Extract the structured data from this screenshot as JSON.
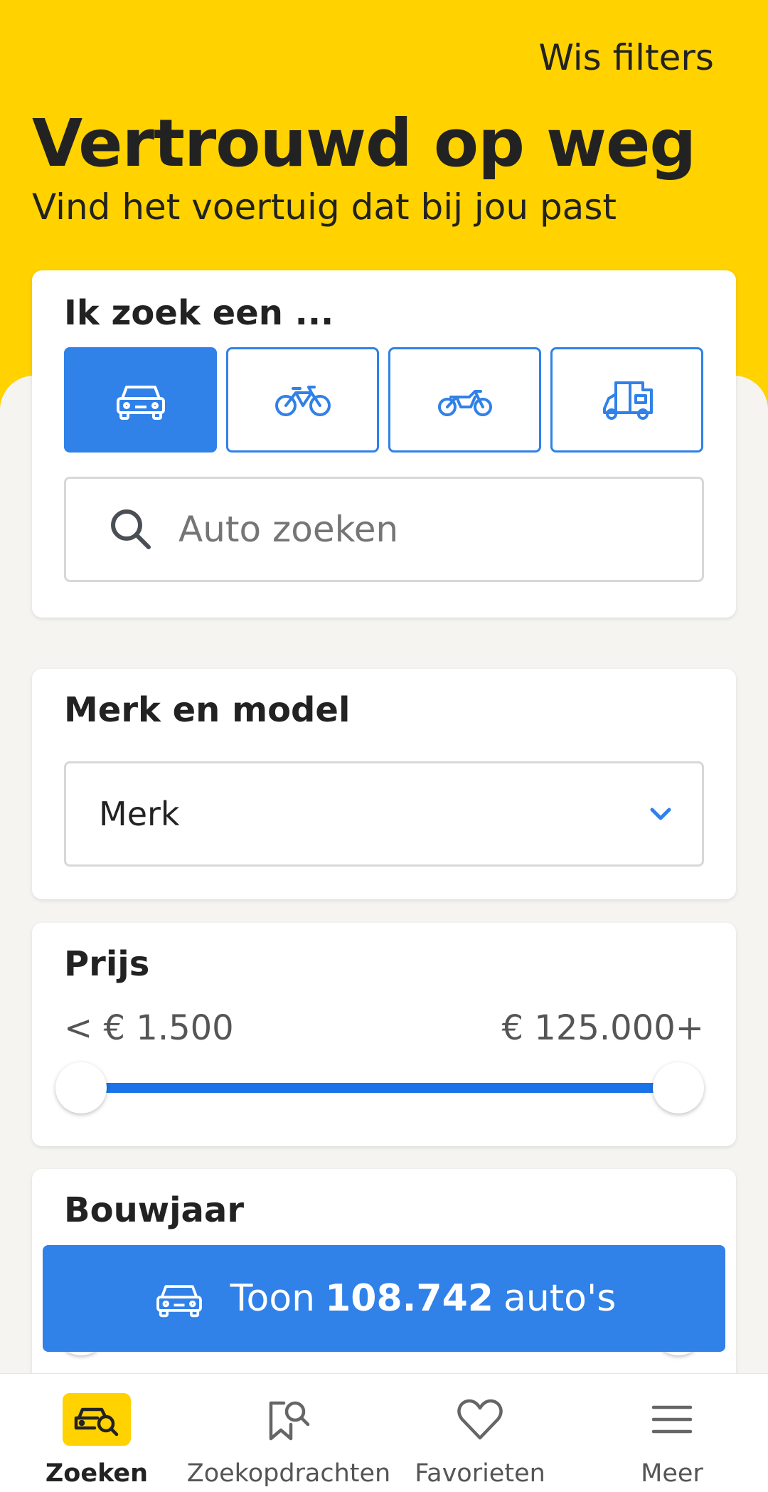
{
  "header": {
    "clear_filters": "Wis filters",
    "title": "Vertrouwd op weg",
    "subtitle": "Vind het voertuig dat bij jou past"
  },
  "search_card": {
    "heading": "Ik zoek een ...",
    "vehicle_types": [
      {
        "icon": "car-icon",
        "selected": true
      },
      {
        "icon": "bicycle-icon",
        "selected": false
      },
      {
        "icon": "motorcycle-icon",
        "selected": false
      },
      {
        "icon": "camper-icon",
        "selected": false
      }
    ],
    "search_placeholder": "Auto zoeken"
  },
  "brand_card": {
    "heading": "Merk en model",
    "brand_select_value": "Merk"
  },
  "price_card": {
    "heading": "Prijs",
    "min_label": "< € 1.500",
    "max_label": "€ 125.000+",
    "range_fraction": [
      0,
      1
    ]
  },
  "year_card": {
    "heading": "Bouwjaar"
  },
  "cta": {
    "prefix": "Toon",
    "count": "108.742",
    "suffix": "auto's"
  },
  "bottom_nav": [
    {
      "label": "Zoeken",
      "icon": "car-search-icon",
      "active": true
    },
    {
      "label": "Zoekopdrachten",
      "icon": "saved-search-icon",
      "active": false
    },
    {
      "label": "Favorieten",
      "icon": "heart-icon",
      "active": false
    },
    {
      "label": "Meer",
      "icon": "menu-icon",
      "active": false
    }
  ],
  "colors": {
    "brand_yellow": "#ffd200",
    "accent_blue": "#3081e8",
    "slider_blue": "#1a73e8"
  }
}
